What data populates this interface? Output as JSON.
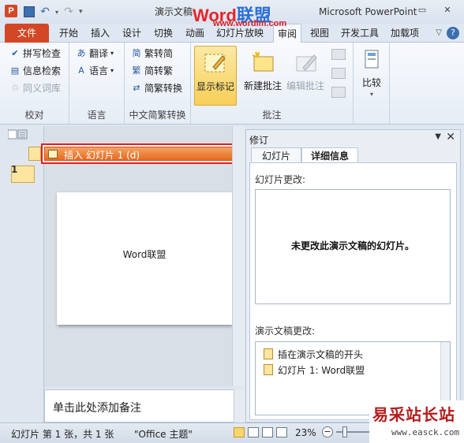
{
  "titlebar": {
    "app_icon": "P",
    "title_left": "演示文稿",
    "title_right": "Microsoft PowerPoint",
    "watermark_word": "Word",
    "watermark_brand": "联盟",
    "watermark_url": "www.wordlm.com",
    "quick_access_icons": [
      "save-icon",
      "undo-icon",
      "redo-icon",
      "customize-qat-icon"
    ],
    "minimize": "–",
    "restore": "▭",
    "close": "✕"
  },
  "tabs": {
    "file": "文件",
    "items": [
      "开始",
      "插入",
      "设计",
      "切换",
      "动画",
      "幻灯片放映",
      "审阅",
      "视图",
      "开发工具",
      "加载项"
    ],
    "active": "审阅",
    "help": "?",
    "minimize_ribbon": "▽"
  },
  "ribbon": {
    "proofing": {
      "label": "校对",
      "spell_check": "拼写检查",
      "research": "信息检索",
      "thesaurus": "同义词库"
    },
    "language": {
      "label": "语言",
      "translate": "翻译",
      "language": "语言"
    },
    "chinese_conversion": {
      "label": "中文简繁转换",
      "to_simplified": "繁转简",
      "to_traditional": "简转繁",
      "convert": "简繁转换"
    },
    "comments": {
      "label": "批注",
      "show_markup": "显示标记",
      "new_comment": "新建批注",
      "edit_comment": "编辑批注"
    },
    "compare": {
      "label": "",
      "compare": "比较"
    }
  },
  "thumbnails": {
    "slide_number": "1"
  },
  "editor": {
    "revision_marker_text": "插入 幻灯片 1 (d)",
    "slide_text": "Word联盟",
    "notes_placeholder": "单击此处添加备注"
  },
  "revisions_pane": {
    "title": "修订",
    "menu": "▼",
    "close": "✕",
    "tabs": [
      "幻灯片",
      "详细信息"
    ],
    "active_tab": "详细信息",
    "slide_changes_label": "幻灯片更改:",
    "no_changes_text": "未更改此演示文稿的幻灯片。",
    "presentation_changes_label": "演示文稿更改:",
    "presentation_changes": [
      "插在演示文稿的开头",
      "幻灯片 1: Word联盟"
    ]
  },
  "statusbar": {
    "slide_info": "幻灯片 第 1 张，共 1 张",
    "theme": "\"Office 主题\"",
    "zoom": "23%",
    "zoom_minus": "−"
  },
  "watermark_corner": {
    "name": "易采站长站",
    "url": "www.easck.com"
  }
}
